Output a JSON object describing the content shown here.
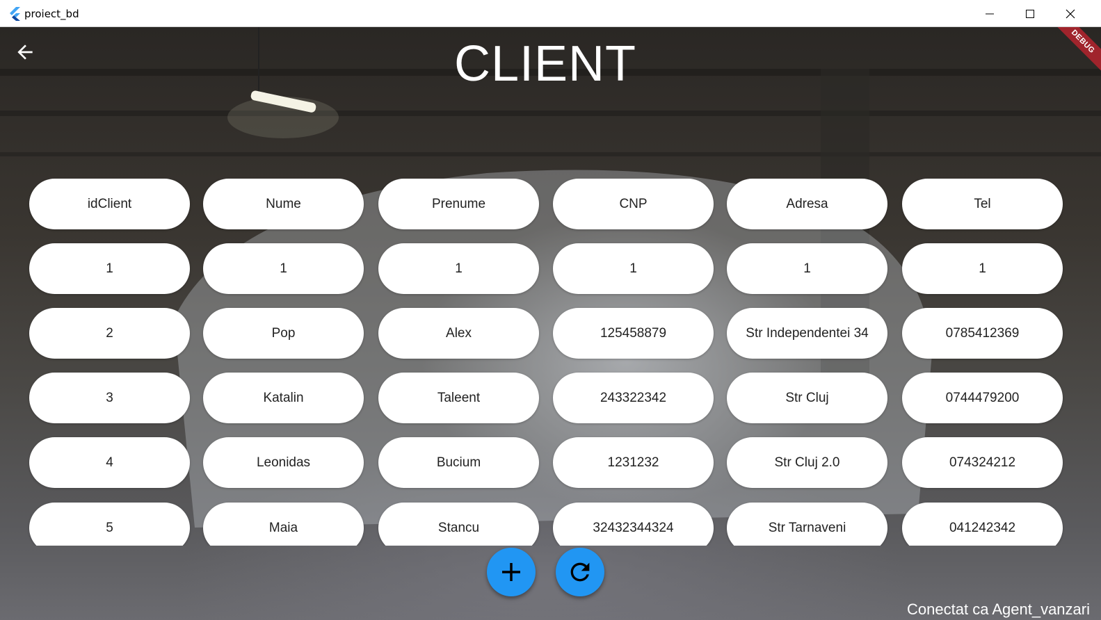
{
  "window": {
    "title": "proiect_bd"
  },
  "page": {
    "title": "CLIENT",
    "debug_banner": "DEBUG",
    "status": "Conectat ca Agent_vanzari"
  },
  "table": {
    "headers": [
      "idClient",
      "Nume",
      "Prenume",
      "CNP",
      "Adresa",
      "Tel"
    ],
    "rows": [
      [
        "1",
        "1",
        "1",
        "1",
        "1",
        "1"
      ],
      [
        "2",
        "Pop",
        "Alex",
        "125458879",
        "Str Independentei 34",
        "0785412369"
      ],
      [
        "3",
        "Katalin",
        "Taleent",
        "243322342",
        "Str Cluj",
        "0744479200"
      ],
      [
        "4",
        "Leonidas",
        "Bucium",
        "1231232",
        "Str Cluj 2.0",
        "074324212"
      ],
      [
        "5",
        "Maia",
        "Stancu",
        "32432344324",
        "Str Tarnaveni",
        "041242342"
      ]
    ]
  },
  "actions": {
    "add_icon": "plus-icon",
    "refresh_icon": "refresh-icon"
  },
  "colors": {
    "accent": "#2196f3",
    "debug": "#a0242c"
  }
}
